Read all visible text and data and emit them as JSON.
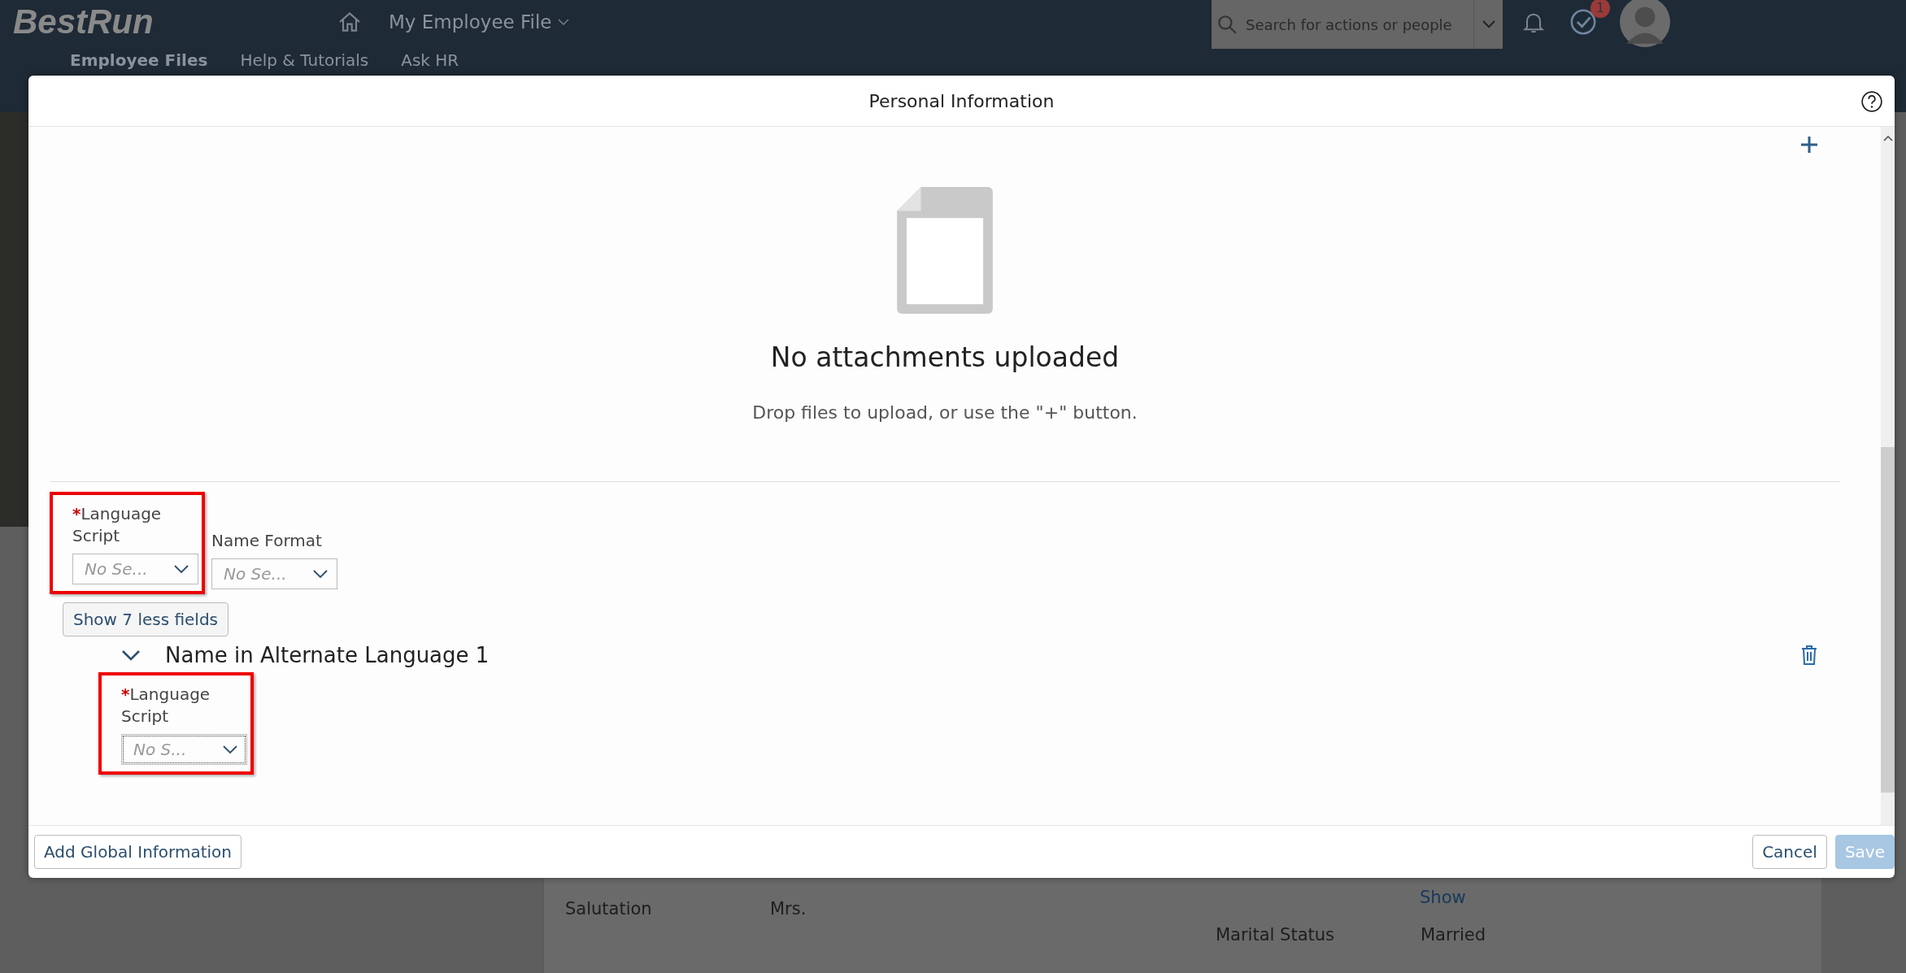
{
  "shell": {
    "logo": "BestRun",
    "nav_title": "My Employee File",
    "search": {
      "placeholder": "Search for actions or people"
    },
    "tasks_badge": "1",
    "tabs": [
      {
        "label": "Employee Files",
        "selected": true
      },
      {
        "label": "Help & Tutorials",
        "selected": false
      },
      {
        "label": "Ask HR",
        "selected": false
      }
    ],
    "background_fields": [
      {
        "label": "Salutation",
        "value": "Mrs.",
        "kind": "text"
      },
      {
        "label": "Marital Status",
        "value": "Married",
        "kind": "text"
      }
    ],
    "background_link": "Show"
  },
  "dialog": {
    "title": "Personal Information",
    "attachments": {
      "title": "No attachments uploaded",
      "hint": "Drop files to upload, or use the \"+\" button."
    },
    "fields": [
      {
        "label": "Language Script",
        "required_mark": "*",
        "highlighted": true,
        "placeholder": "No Se..."
      },
      {
        "label": "Name Format",
        "highlighted": false,
        "placeholder": "No Se..."
      }
    ],
    "toggle_button": "Show 7 less fields",
    "sections": [
      {
        "title": "Name in Alternate Language 1",
        "expanded": true,
        "fields": [
          {
            "label": "Language Script",
            "required_mark": "*",
            "highlighted": true,
            "placeholder": "No S..."
          }
        ]
      }
    ],
    "footer": {
      "left_button": "Add Global Information",
      "buttons": [
        {
          "label": "Cancel",
          "disabled": false
        },
        {
          "label": "Save",
          "disabled": true
        }
      ]
    }
  }
}
